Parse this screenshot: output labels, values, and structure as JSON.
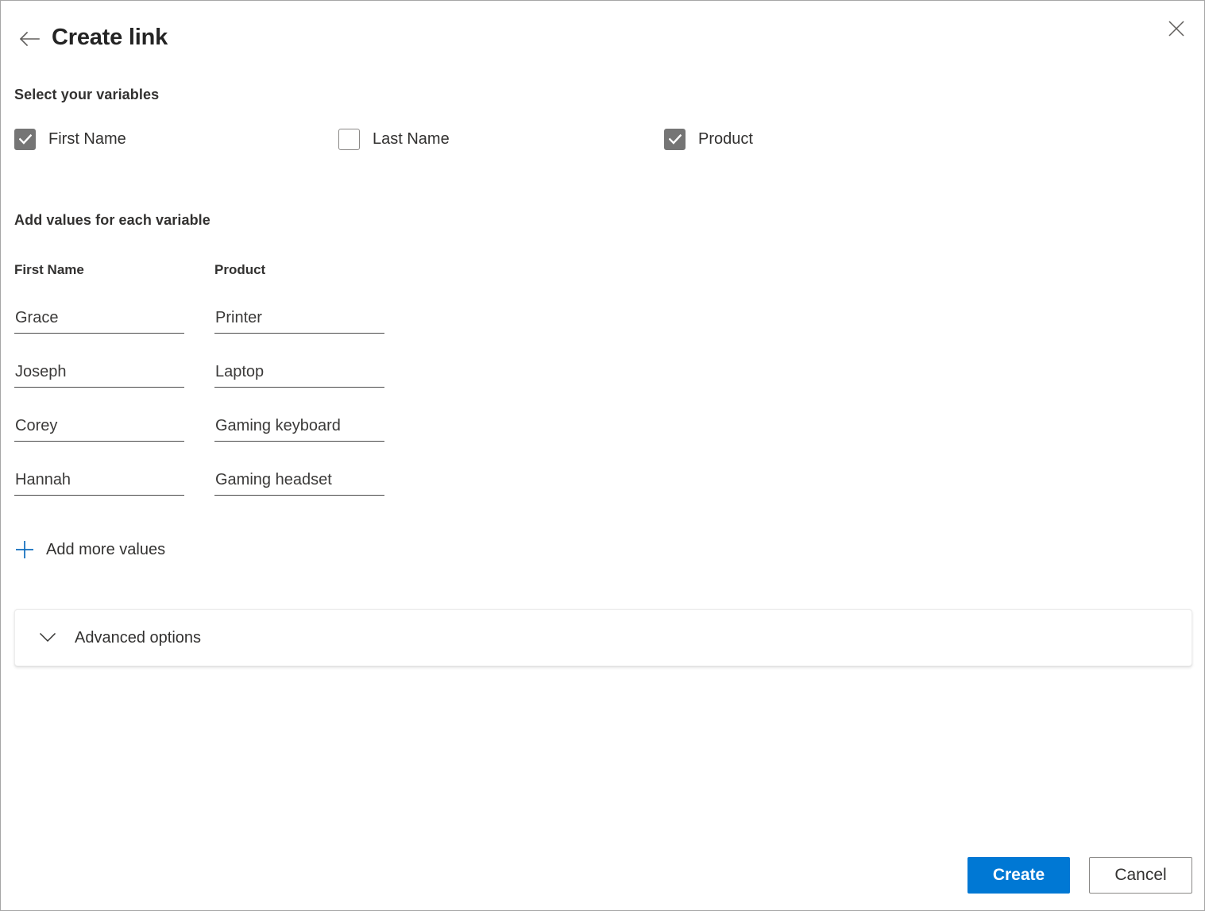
{
  "window": {
    "title": "Create link",
    "back_icon": "arrow-left-icon",
    "close_icon": "close-icon"
  },
  "variables_section": {
    "heading": "Select your variables",
    "checkboxes": [
      {
        "label": "First Name",
        "checked": true
      },
      {
        "label": "Last Name",
        "checked": false
      },
      {
        "label": "Product",
        "checked": true
      }
    ]
  },
  "values_section": {
    "heading": "Add values for each variable",
    "columns": [
      {
        "header": "First Name",
        "values": [
          "Grace",
          "Joseph",
          "Corey",
          "Hannah"
        ]
      },
      {
        "header": "Product",
        "values": [
          "Printer",
          "Laptop",
          "Gaming keyboard",
          "Gaming headset"
        ]
      }
    ],
    "add_more_label": "Add more values",
    "add_more_icon": "plus-icon"
  },
  "advanced": {
    "label": "Advanced options",
    "icon": "chevron-down-icon",
    "expanded": false
  },
  "footer": {
    "create_label": "Create",
    "cancel_label": "Cancel"
  },
  "colors": {
    "accent": "#0078d4",
    "checkbox_checked": "#757575",
    "checkbox_border": "#8a8886",
    "text": "#323130",
    "input_underline": "#4a4a4a"
  }
}
